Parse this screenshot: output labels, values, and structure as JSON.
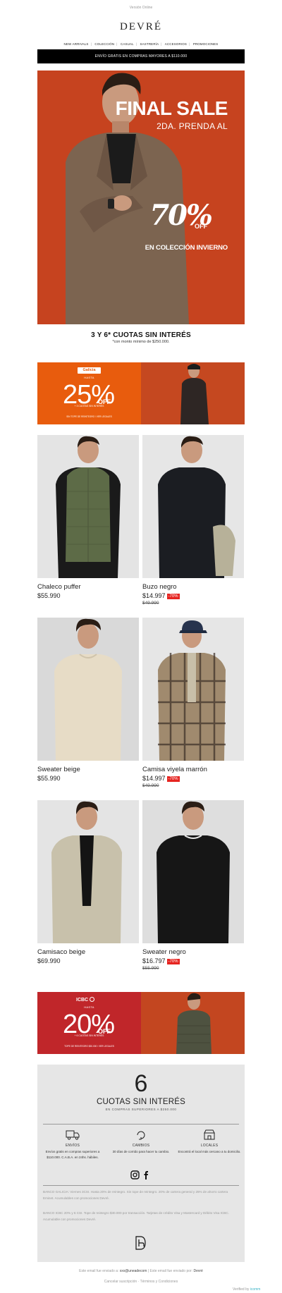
{
  "header": {
    "online_link": "Versión Online",
    "logo": "DEVRÉ",
    "nav": [
      "NEW ARRIVALS",
      "COLECCIÓN",
      "CASUAL",
      "SASTRERÍA",
      "ACCESORIOS",
      "PROMOCIONES"
    ],
    "shipping": "ENVÍO GRATIS EN COMPRAS MAYORES A $110.000"
  },
  "hero": {
    "title": "FINAL SALE",
    "line2": "2DA. PRENDA AL",
    "percent": "70%",
    "off": "OFF",
    "line4": "EN COLECCIÓN INVIERNO",
    "bg_color": "#c6431f"
  },
  "installments": {
    "title": "3 Y 6* CUOTAS SIN INTERÉS",
    "note": "*con monto mínimo de $250.000."
  },
  "banner_galicia": {
    "bank": "Galicia",
    "hasta": "HASTA",
    "percent": "25%",
    "off": "OFF",
    "sub": "+ 3 CUOTAS SIN INTERÉS",
    "tope": "SIN TOPE DE REINTEGRO / VER LEGALES",
    "color": "#e85c0d"
  },
  "products": [
    {
      "name": "Chaleco puffer",
      "price": "$55.990",
      "badge": "",
      "old_price": ""
    },
    {
      "name": "Buzo negro",
      "price": "$14.997",
      "badge": "-70%",
      "old_price": "$49.990"
    },
    {
      "name": "Sweater beige",
      "price": "$55.990",
      "badge": "",
      "old_price": ""
    },
    {
      "name": "Camisa viyela marrón",
      "price": "$14.997",
      "badge": "-70%",
      "old_price": "$49.990"
    },
    {
      "name": "Camisaco beige",
      "price": "$69.990",
      "badge": "",
      "old_price": ""
    },
    {
      "name": "Sweater negro",
      "price": "$16.797",
      "badge": "-70%",
      "old_price": "$55.990"
    }
  ],
  "banner_icbc": {
    "bank": "ICBC",
    "hasta": "HASTA",
    "percent": "20%",
    "off": "OFF",
    "sub": "+ 6 CUOTAS SIN INTERÉS",
    "tope": "TOPE DE REINTEGRO $30.000 / VER LEGALES",
    "color": "#c0262a"
  },
  "footer": {
    "six": "6",
    "six_title": "CUOTAS SIN INTERÉS",
    "six_sub": "EN COMPRAS SUPERIORES A $250.000",
    "features": [
      {
        "label": "ENVÍOS",
        "text": "Envíos gratis en compras superiores a $110.000. C.A.B.A. en 24hs. hábiles.",
        "icon": "truck-icon"
      },
      {
        "label": "CAMBIOS",
        "text": "30 días de corrido para hacer tu cambio.",
        "icon": "exchange-icon"
      },
      {
        "label": "LOCALES",
        "text": "Encontrá el local más cercano a tu domicilio.",
        "icon": "store-icon"
      }
    ],
    "legal1": "BANCO GALICIA: Viernes 3CSI. Hasta 20% de reintegro. Sin tope de reintegro. 20% de cartera general y 25% de ahorro cartera Eminet. Acumulables con promociones Devré.",
    "legal2": "BANCO ICBC 20% y 6 CSI. Tope de reintegro $30.000 por transacción. Tarjetas de crédito Visa y Mastercard y Débito Visa ICBC. Acumulable con promociones Devré.",
    "email_line_a": "Este email fue enviado a:",
    "email": "xxx@uneadecom",
    "email_line_b": "| Este email fue enviado por:",
    "sender": "Devré",
    "unsubscribe": "Cancelar suscripción",
    "terms": "Términos y Condiciones",
    "verified": "Verified by",
    "verified_brand": "icomm"
  }
}
